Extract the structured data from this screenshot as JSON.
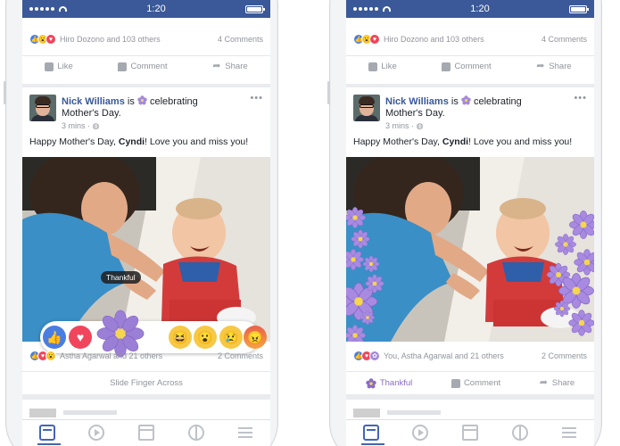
{
  "status_bar": {
    "time": "1:20"
  },
  "top_post": {
    "reactions_text": "Hiro Dozono and 103 others",
    "comments_text": "4 Comments",
    "like_label": "Like",
    "comment_label": "Comment",
    "share_label": "Share"
  },
  "post": {
    "author": "Nick Williams",
    "is_text": "is",
    "activity": "celebrating",
    "activity_object": "Mother's Day.",
    "time": "3 mins",
    "text_before": "Happy Mother's Day, ",
    "text_bold": "Cyndi",
    "text_after": "! Love you and miss you!",
    "more_icon": "more-horizontal-icon"
  },
  "left_screen": {
    "tooltip": "Thankful",
    "footer_reactions_text": "Astha Agarwal and 21 others",
    "footer_comments_text": "2 Comments",
    "slide_hint": "Slide Finger Across",
    "reactions": [
      "like",
      "love",
      "thankful",
      "haha",
      "wow",
      "sad",
      "angry"
    ]
  },
  "right_screen": {
    "footer_reactions_text": "You, Astha Agarwal and 21 others",
    "footer_comments_text": "2 Comments",
    "thankful_label": "Thankful",
    "comment_label": "Comment",
    "share_label": "Share"
  },
  "colors": {
    "facebook_blue": "#3b5998",
    "thankful_purple": "#a489d8",
    "like_blue": "#4a7de2",
    "love_red": "#f0455c"
  }
}
